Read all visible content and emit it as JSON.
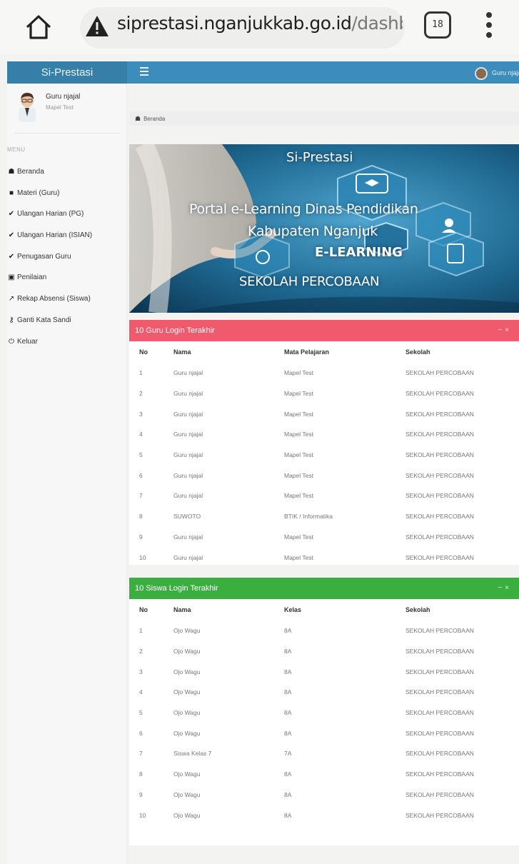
{
  "browser": {
    "url_host": "siprestasi.nganjukkab.go.id",
    "url_path": "/dashbo",
    "tab_count": "18"
  },
  "app": {
    "brand": "Si-Prestasi",
    "user_top": "Guru njajal"
  },
  "sidebar": {
    "profile_name": "Guru njajal",
    "profile_subject": "Mapel Test",
    "menu_header": "MENU",
    "items": [
      {
        "label": "Beranda",
        "icon": "dashboard-icon"
      },
      {
        "label": "Materi (Guru)",
        "icon": "book-icon"
      },
      {
        "label": "Ulangan Harian (PG)",
        "icon": "check-icon"
      },
      {
        "label": "Ulangan Harian (ISIAN)",
        "icon": "check-icon"
      },
      {
        "label": "Penugasan Guru",
        "icon": "check-icon"
      },
      {
        "label": "Penilaian",
        "icon": "calculator-icon"
      },
      {
        "label": "Rekap Absensi (Siswa)",
        "icon": "chart-icon"
      },
      {
        "label": "Ganti Kata Sandi",
        "icon": "key-icon"
      },
      {
        "label": "Keluar",
        "icon": "power-icon"
      }
    ]
  },
  "breadcrumb": "Beranda",
  "banner": {
    "title": "Si-Prestasi",
    "subtitle_line1": "Portal e-Learning Dinas Pendidikan",
    "subtitle_line2": "Kabupaten Nganjuk",
    "badge": "E-LEARNING",
    "school": "SEKOLAH PERCOBAAN"
  },
  "guru_box": {
    "title": "10 Guru Login Terakhir",
    "header_color": "#f05a6d",
    "columns": [
      "No",
      "Nama",
      "Mata Pelajaran",
      "Sekolah"
    ],
    "rows": [
      [
        "1",
        "Guru njajal",
        "Mapel Test",
        "SEKOLAH PERCOBAAN"
      ],
      [
        "2",
        "Guru njajal",
        "Mapel Test",
        "SEKOLAH PERCOBAAN"
      ],
      [
        "3",
        "Guru njajal",
        "Mapel Test",
        "SEKOLAH PERCOBAAN"
      ],
      [
        "4",
        "Guru njajal",
        "Mapel Test",
        "SEKOLAH PERCOBAAN"
      ],
      [
        "5",
        "Guru njajal",
        "Mapel Test",
        "SEKOLAH PERCOBAAN"
      ],
      [
        "6",
        "Guru njajal",
        "Mapel Test",
        "SEKOLAH PERCOBAAN"
      ],
      [
        "7",
        "Guru njajal",
        "Mapel Test",
        "SEKOLAH PERCOBAAN"
      ],
      [
        "8",
        "SUWOTO",
        "BTIK / Informatika",
        "SEKOLAH PERCOBAAN"
      ],
      [
        "9",
        "Guru njajal",
        "Mapel Test",
        "SEKOLAH PERCOBAAN"
      ],
      [
        "10",
        "Guru njajal",
        "Mapel Test",
        "SEKOLAH PERCOBAAN"
      ]
    ]
  },
  "siswa_box": {
    "title": "10 Siswa Login Terakhir",
    "header_color": "#3aae3f",
    "columns": [
      "No",
      "Nama",
      "Kelas",
      "Sekolah"
    ],
    "rows": [
      [
        "1",
        "Ojo Wagu",
        "8A",
        "SEKOLAH PERCOBAAN"
      ],
      [
        "2",
        "Ojo Wagu",
        "8A",
        "SEKOLAH PERCOBAAN"
      ],
      [
        "3",
        "Ojo Wagu",
        "8A",
        "SEKOLAH PERCOBAAN"
      ],
      [
        "4",
        "Ojo Wagu",
        "8A",
        "SEKOLAH PERCOBAAN"
      ],
      [
        "5",
        "Ojo Wagu",
        "8A",
        "SEKOLAH PERCOBAAN"
      ],
      [
        "6",
        "Ojo Wagu",
        "8A",
        "SEKOLAH PERCOBAAN"
      ],
      [
        "7",
        "Siswa Kelas 7",
        "7A",
        "SEKOLAH PERCOBAAN"
      ],
      [
        "8",
        "Ojo Wagu",
        "8A",
        "SEKOLAH PERCOBAAN"
      ],
      [
        "9",
        "Ojo Wagu",
        "8A",
        "SEKOLAH PERCOBAAN"
      ],
      [
        "10",
        "Ojo Wagu",
        "8A",
        "SEKOLAH PERCOBAAN"
      ]
    ]
  }
}
